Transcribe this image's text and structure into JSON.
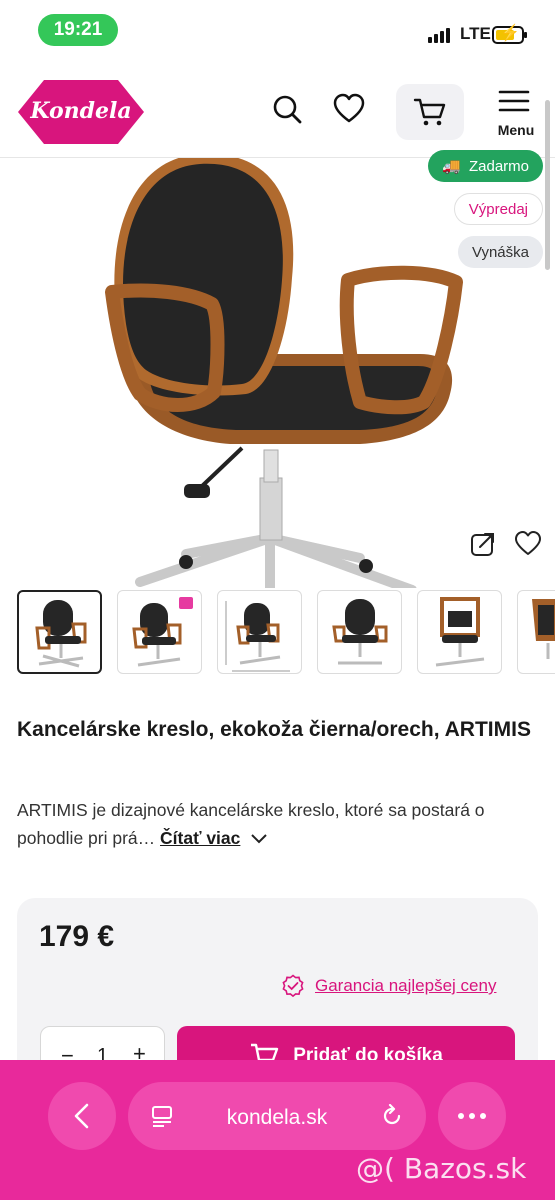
{
  "status_bar": {
    "time": "19:21",
    "network": "LTE"
  },
  "header": {
    "logo": "Kondela",
    "menu_label": "Menu"
  },
  "product": {
    "badges": {
      "free": "Zadarmo",
      "sale": "Výpredaj",
      "carry": "Vynáška"
    },
    "title": "Kancelárske kreslo, ekokoža čierna/orech, ARTIMIS",
    "description": "ARTIMIS je dizajnové kancelárske kreslo, ktoré sa postará o pohodlie pri prá…",
    "read_more": "Čítať viac",
    "price": "179 €",
    "guarantee": "Garancia najlepšej ceny",
    "quantity": "1",
    "add_to_cart": "Pridať do košíka"
  },
  "browser": {
    "url": "kondela.sk"
  },
  "watermark": "@( Bazos.sk",
  "colors": {
    "brand": "#d8157d",
    "free_badge": "#23a35e",
    "status_time": "#34c759"
  }
}
